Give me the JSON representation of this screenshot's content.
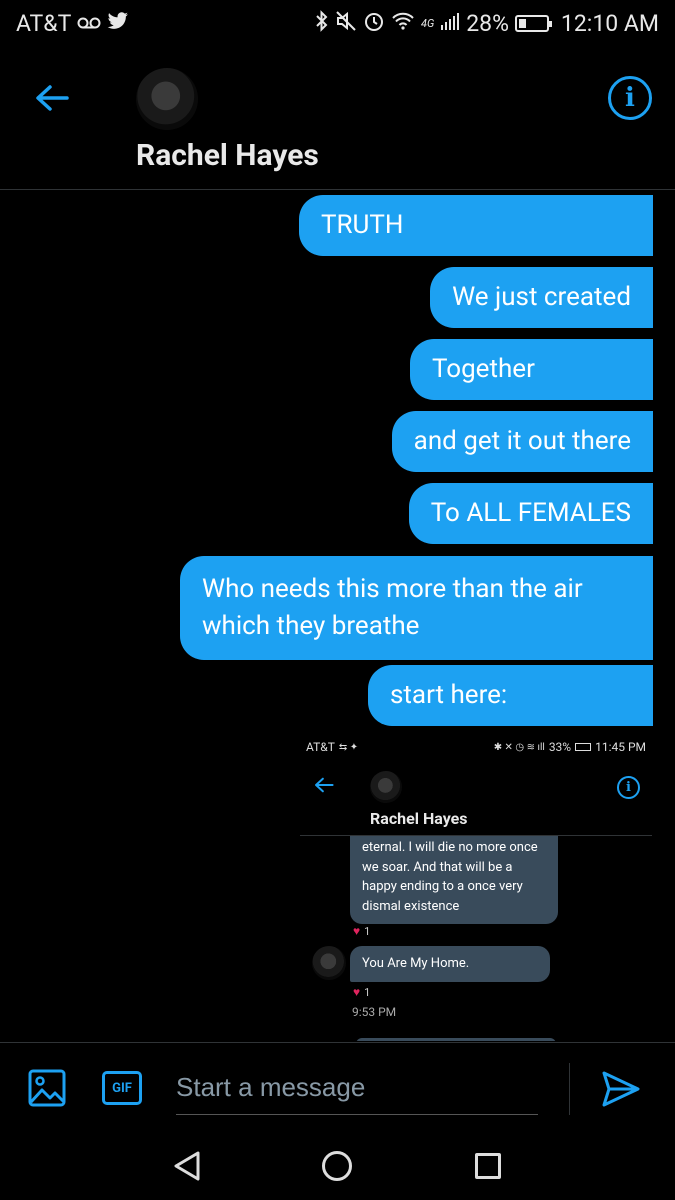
{
  "status_bar": {
    "carrier": "AT&T",
    "icons_left": [
      "voicemail-icon",
      "twitter-icon"
    ],
    "icons_right": [
      "bluetooth-icon",
      "mute-icon",
      "alarm-icon",
      "wifi-icon",
      "4g-icon",
      "signal-icon"
    ],
    "battery": "28%",
    "battery_level": 0.28,
    "time": "12:10 AM"
  },
  "header": {
    "contact_name": "Rachel Hayes",
    "back_icon": "arrow-left-icon",
    "info_icon": "info-icon"
  },
  "messages": [
    {
      "text": "TRUTH",
      "sender": "me"
    },
    {
      "text": "We just created",
      "sender": "me"
    },
    {
      "text": "Together",
      "sender": "me"
    },
    {
      "text": "and get it out there",
      "sender": "me"
    },
    {
      "text": "To ALL FEMALES",
      "sender": "me"
    },
    {
      "text": "Who needs this more than the air\nwhich they breathe",
      "sender": "me"
    },
    {
      "text": "start here:",
      "sender": "me"
    }
  ],
  "embedded_screenshot": {
    "status_bar": {
      "carrier": "AT&T",
      "battery": "33%",
      "time": "11:45 PM"
    },
    "header": {
      "contact_name": "Rachel Hayes"
    },
    "messages": [
      {
        "text": "eternal. I will die no more once we soar. And that will be a happy ending to a once very dismal existence",
        "likes": "1"
      },
      {
        "text": "You Are My Home.",
        "likes": "1",
        "time": "9:53 PM"
      }
    ]
  },
  "composer": {
    "placeholder": "Start a message",
    "gif_label": "GIF",
    "media_icon": "image-icon",
    "send_icon": "send-icon"
  },
  "nav_bar": {
    "icons": [
      "nav-back-icon",
      "nav-home-icon",
      "nav-recents-icon"
    ]
  },
  "colors": {
    "accent": "#1da1f2",
    "background": "#000000",
    "received_bubble": "#394b5b"
  }
}
